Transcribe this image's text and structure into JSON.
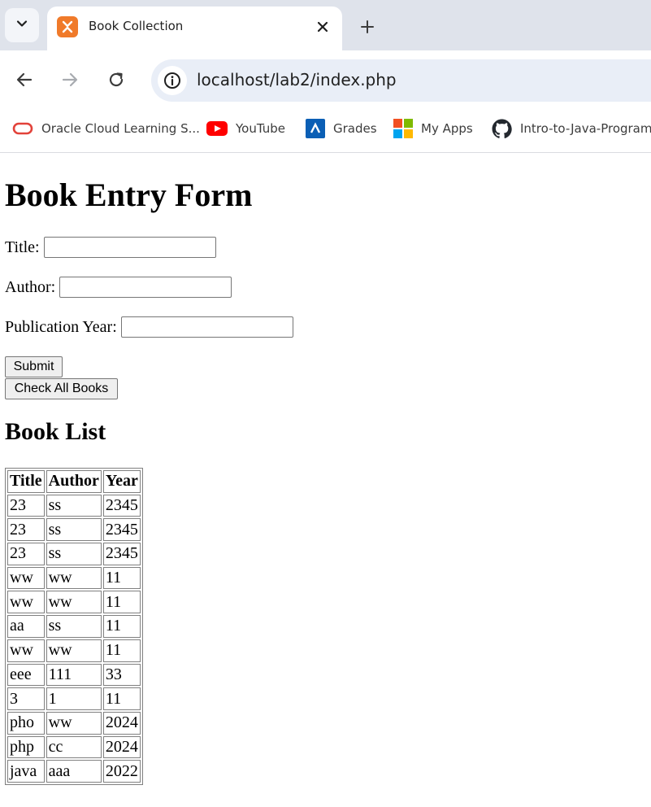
{
  "browser": {
    "tab": {
      "title": "Book Collection",
      "favicon": "xampp-icon"
    },
    "url": "localhost/lab2/index.php",
    "bookmarks": [
      {
        "label": "Oracle Cloud Learning S...",
        "icon": "oracle-icon"
      },
      {
        "label": "YouTube",
        "icon": "youtube-icon"
      },
      {
        "label": "Grades",
        "icon": "grades-icon"
      },
      {
        "label": "My Apps",
        "icon": "microsoft-apps-icon"
      },
      {
        "label": "Intro-to-Java-Programm",
        "icon": "github-icon"
      }
    ]
  },
  "form": {
    "heading": "Book Entry Form",
    "title_label": "Title:",
    "author_label": "Author:",
    "year_label": "Publication Year:",
    "submit_label": "Submit",
    "check_all_label": "Check All Books"
  },
  "book_list": {
    "heading": "Book List",
    "columns": [
      "Title",
      "Author",
      "Year"
    ],
    "rows": [
      [
        "23",
        "ss",
        "2345"
      ],
      [
        "23",
        "ss",
        "2345"
      ],
      [
        "23",
        "ss",
        "2345"
      ],
      [
        "ww",
        "ww",
        "11"
      ],
      [
        "ww",
        "ww",
        "11"
      ],
      [
        "aa",
        "ss",
        "11"
      ],
      [
        "ww",
        "ww",
        "11"
      ],
      [
        "eee",
        "111",
        "33"
      ],
      [
        "3",
        "1",
        "11"
      ],
      [
        "pho",
        "ww",
        "2024"
      ],
      [
        "php",
        "cc",
        "2024"
      ],
      [
        "java",
        "aaa",
        "2022"
      ]
    ]
  }
}
